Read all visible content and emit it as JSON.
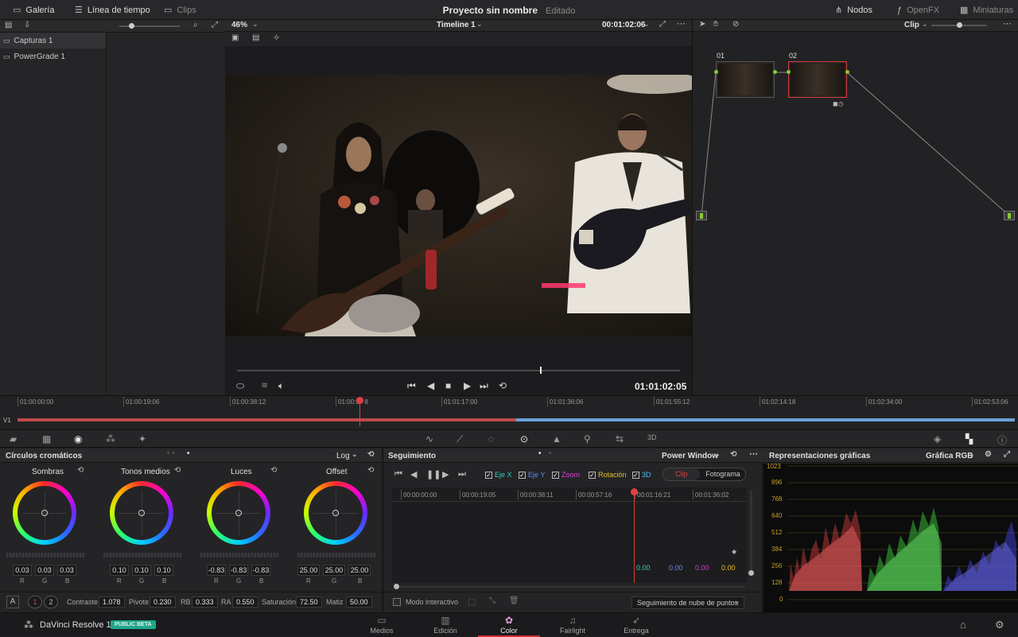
{
  "topbar": {
    "gallery": "Galería",
    "timeline": "Línea de tiempo",
    "clips": "Clips",
    "project_title": "Proyecto sin nombre",
    "edited": "Editado",
    "nodes": "Nodos",
    "openfx": "OpenFX",
    "thumbnails": "Miniaturas"
  },
  "gallery": {
    "items": [
      "Capturas 1",
      "PowerGrade 1"
    ]
  },
  "viewer": {
    "zoom": "46%",
    "timeline_name": "Timeline 1",
    "timecode_top": "00:01:02:06",
    "timecode_main": "01:01:02:05"
  },
  "nodes_panel": {
    "mode": "Clip",
    "node1": "01",
    "node2": "02"
  },
  "ruler": {
    "ticks": [
      "01:00:00:00",
      "01:00:19:06",
      "01:00:38:12",
      "01:00:5   8",
      "01:01:17:00",
      "01:01:36:06",
      "01:01:55:12",
      "01:02:14:18",
      "01:02:34:00",
      "01:02:53:06"
    ],
    "track": "V1"
  },
  "color_wheels": {
    "title": "Círculos cromáticos",
    "mode": "Log",
    "wheels": [
      {
        "name": "Sombras",
        "vals": [
          "0.03",
          "0.03",
          "0.03"
        ]
      },
      {
        "name": "Tonos medios",
        "vals": [
          "0.10",
          "0.10",
          "0.10"
        ]
      },
      {
        "name": "Luces",
        "vals": [
          "-0.83",
          "-0.83",
          "-0.83"
        ]
      },
      {
        "name": "Offset",
        "vals": [
          "25.00",
          "25.00",
          "25.00"
        ]
      }
    ],
    "channels": [
      "R",
      "G",
      "B"
    ],
    "footer": {
      "a": "A",
      "p1": "1",
      "p2": "2",
      "contrast_label": "Contraste",
      "contrast": "1.078",
      "pivot_label": "Pivote",
      "pivot": "0.230",
      "rb_label": "RB",
      "rb": "0.333",
      "ra_label": "RA",
      "ra": "0.550",
      "sat_label": "Saturación",
      "sat": "72.50",
      "hue_label": "Matiz",
      "hue": "50.00"
    }
  },
  "tracker": {
    "title": "Seguimiento",
    "mode": "Power Window",
    "checks": [
      "Eje X",
      "Eje Y",
      "Zoom",
      "Rotación",
      "3D"
    ],
    "check_colors": [
      "#33d0c0",
      "#5a8cff",
      "#d040d0",
      "#e8c030",
      "#40c0ff"
    ],
    "tab_clip": "Clip",
    "tab_frame": "Fotograma",
    "ticks": [
      "00:00:00:00",
      "00:00:19:05",
      "00:00:38:11",
      "00:00:57:16",
      "00:01:16:21",
      "00:01:36:02"
    ],
    "values": [
      "0.00",
      "0.00",
      "0.00",
      "0.00"
    ],
    "value_colors": [
      "#33d0c0",
      "#5a8cff",
      "#d040d0",
      "#e8c030"
    ],
    "interactive": "Modo interactivo",
    "cloud": "Seguimiento de nube de puntos"
  },
  "scopes": {
    "title": "Representaciones gráficas",
    "mode": "Gráfica RGB",
    "y_labels": [
      "1023",
      "896",
      "768",
      "640",
      "512",
      "384",
      "256",
      "128",
      "0"
    ]
  },
  "bottomnav": {
    "app": "DaVinci Resolve 14",
    "badge": "PUBLIC BETA",
    "pages": [
      "Medios",
      "Edición",
      "Color",
      "Fairlight",
      "Entrega"
    ],
    "active": "Color"
  }
}
